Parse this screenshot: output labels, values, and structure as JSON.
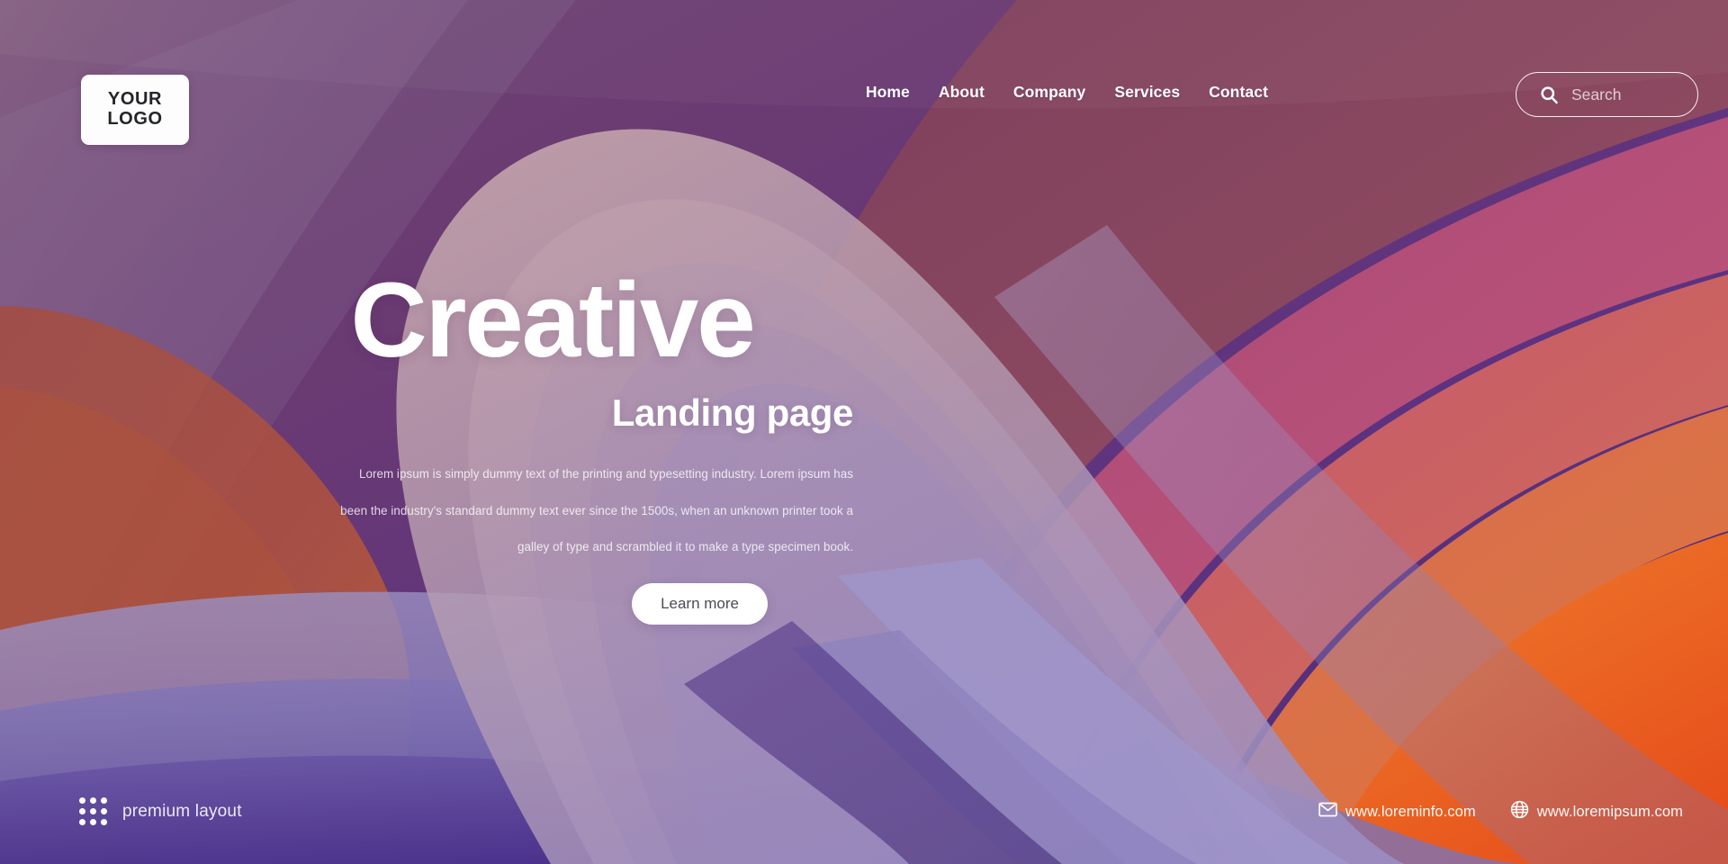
{
  "header": {
    "logo": {
      "line1": "YOUR",
      "line2": "LOGO",
      "icon": "logo-mark"
    },
    "nav": [
      {
        "label": "Home"
      },
      {
        "label": "About"
      },
      {
        "label": "Company"
      },
      {
        "label": "Services"
      },
      {
        "label": "Contact"
      }
    ],
    "search": {
      "placeholder": "Search",
      "value": "",
      "icon": "search-icon"
    }
  },
  "hero": {
    "title": "Creative",
    "subtitle": "Landing page",
    "paragraph_lines": [
      "Lorem ipsum is simply dummy text of the printing and typesetting industry. Lorem ipsum has",
      "been the industry's standard dummy text ever since the 1500s, when an unknown printer took a",
      "galley of type and scrambled it to make a type specimen book."
    ],
    "cta_label": "Learn more"
  },
  "footer": {
    "premium_label": "premium layout",
    "premium_icon": "dot-grid-icon",
    "contacts": [
      {
        "label": "www.loreminfo.com",
        "icon": "envelope-icon"
      },
      {
        "label": "www.loremipsum.com",
        "icon": "globe-icon"
      }
    ]
  },
  "colors": {
    "purple_dark": "#4a2a78",
    "purple_top_right": "#5a2d6b",
    "maroon": "#8a4a63",
    "magenta": "#b8507e",
    "coral": "#d9695f",
    "orange": "#e8521f",
    "lavender": "#9a93c8",
    "white": "#ffffff",
    "logo_text": "#262329",
    "cta_text": "#4e4a52"
  }
}
